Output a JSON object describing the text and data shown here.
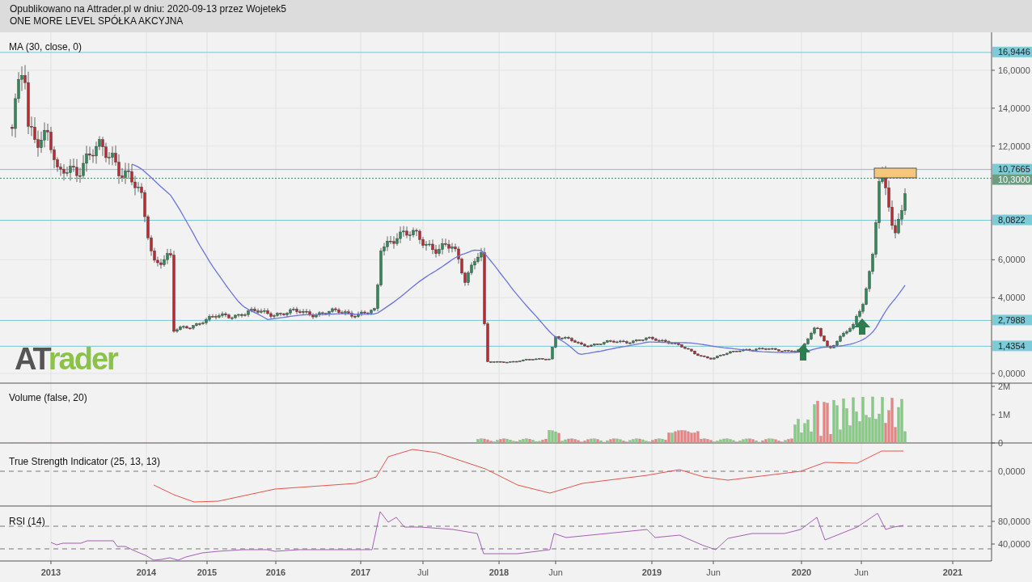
{
  "header": {
    "published": "Opublikowano na Attrader.pl w dniu: 2020-09-13 przez Wojetek5",
    "company": "ONE MORE LEVEL SPÓŁKA AKCYJNA"
  },
  "logo": {
    "dark": "AT",
    "green": "rader"
  },
  "price_panel": {
    "label": "MA (30, close, 0)",
    "ticks": [
      "16,0000",
      "14,0000",
      "12,0000",
      "6,0000",
      "4,0000",
      "0,0000"
    ],
    "levels": [
      {
        "text": "16,9446",
        "kind": "level"
      },
      {
        "text": "10,7665",
        "kind": "level"
      },
      {
        "text": "10,3000",
        "kind": "last"
      },
      {
        "text": "8,0822",
        "kind": "level"
      },
      {
        "text": "2,7988",
        "kind": "level"
      },
      {
        "text": "1,4354",
        "kind": "level"
      }
    ]
  },
  "volume_panel": {
    "label": "Volume (false, 20)",
    "ticks": [
      "2M",
      "1M",
      "0"
    ]
  },
  "tsi_panel": {
    "label": "True Strength Indicator (25, 13, 13)",
    "ticks": [
      "0,0000"
    ]
  },
  "rsi_panel": {
    "label": "RSI (14)",
    "ticks": [
      "80,0000",
      "40,0000"
    ]
  },
  "x_labels": [
    {
      "text": "2013",
      "kind": "year"
    },
    {
      "text": "2014",
      "kind": "year"
    },
    {
      "text": "2015",
      "kind": "year"
    },
    {
      "text": "2016",
      "kind": "year"
    },
    {
      "text": "2017",
      "kind": "year"
    },
    {
      "text": "Jul",
      "kind": "month"
    },
    {
      "text": "2018",
      "kind": "year"
    },
    {
      "text": "Jun",
      "kind": "month"
    },
    {
      "text": "2019",
      "kind": "year"
    },
    {
      "text": "Jun",
      "kind": "month"
    },
    {
      "text": "2020",
      "kind": "year"
    },
    {
      "text": "Jun",
      "kind": "month"
    },
    {
      "text": "2021",
      "kind": "year"
    }
  ]
}
